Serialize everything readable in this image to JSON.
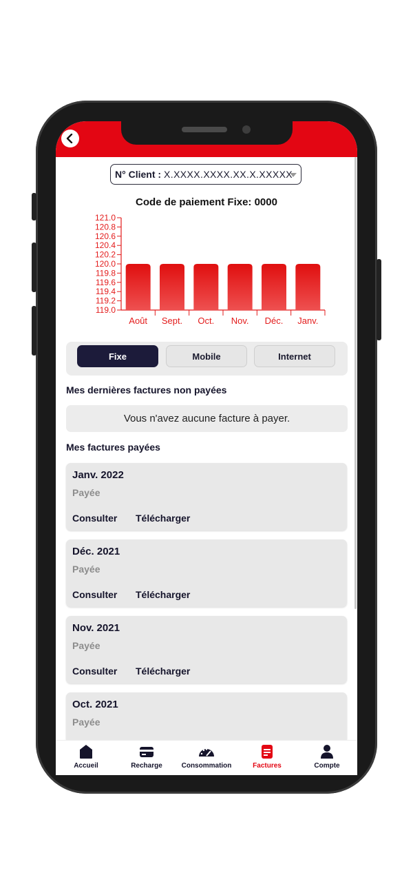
{
  "header": {
    "back_icon": "chevron-left-icon",
    "accent_color": "#e30613"
  },
  "client": {
    "label": "N° Client :",
    "value": "X.XXXX.XXXX.XX.X.XXXXX"
  },
  "chart_data": {
    "type": "bar",
    "title": "Code de paiement Fixe: 0000",
    "categories": [
      "Août",
      "Sept.",
      "Oct.",
      "Nov.",
      "Déc.",
      "Janv."
    ],
    "values": [
      120.0,
      120.0,
      120.0,
      120.0,
      120.0,
      120.0
    ],
    "ylim": [
      119.0,
      121.0
    ],
    "yticks": [
      "119.0",
      "119.2",
      "119.4",
      "119.6",
      "119.8",
      "120.0",
      "120.2",
      "120.4",
      "120.6",
      "120.8",
      "121.0"
    ],
    "xlabel": "",
    "ylabel": "",
    "grid": false,
    "bar_color": "#e31b1b",
    "axis_color": "#e31b1b"
  },
  "tabs": [
    {
      "label": "Fixe",
      "active": true
    },
    {
      "label": "Mobile",
      "active": false
    },
    {
      "label": "Internet",
      "active": false
    }
  ],
  "unpaid": {
    "title": "Mes dernières factures non payées",
    "empty_message": "Vous n'avez aucune facture à payer."
  },
  "paid": {
    "title": "Mes factures payées",
    "items": [
      {
        "month": "Janv. 2022",
        "status": "Payée",
        "action_view": "Consulter",
        "action_download": "Télécharger"
      },
      {
        "month": "Déc. 2021",
        "status": "Payée",
        "action_view": "Consulter",
        "action_download": "Télécharger"
      },
      {
        "month": "Nov. 2021",
        "status": "Payée",
        "action_view": "Consulter",
        "action_download": "Télécharger"
      },
      {
        "month": "Oct. 2021",
        "status": "Payée"
      }
    ]
  },
  "nav": [
    {
      "label": "Accueil",
      "icon": "home-icon",
      "active": false
    },
    {
      "label": "Recharge",
      "icon": "card-icon",
      "active": false
    },
    {
      "label": "Consommation",
      "icon": "gauge-icon",
      "active": false
    },
    {
      "label": "Factures",
      "icon": "invoice-icon",
      "active": true
    },
    {
      "label": "Compte",
      "icon": "user-icon",
      "active": false
    }
  ]
}
